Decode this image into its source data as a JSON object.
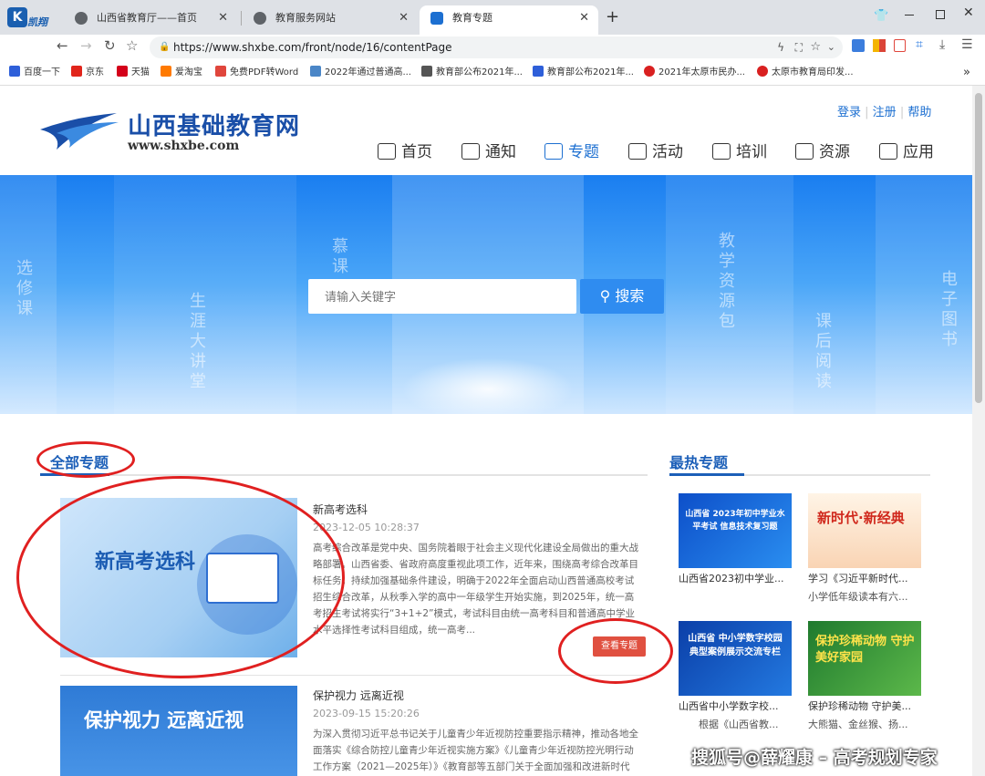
{
  "browser": {
    "tabs": [
      {
        "title": "山西省教育厅——首页"
      },
      {
        "title": "教育服务网站"
      },
      {
        "title": "教育专题"
      }
    ],
    "new_tab": "+",
    "url": "https://www.shxbe.com/front/node/16/contentPage",
    "logo_text": "凯翔",
    "bookmarks": [
      "百度一下",
      "京东",
      "天猫",
      "爱淘宝",
      "免费PDF转Word",
      "2022年通过普通高...",
      "教育部公布2021年...",
      "教育部公布2021年...",
      "2021年太原市民办...",
      "太原市教育局印发..."
    ],
    "bookmark_more": "»"
  },
  "site": {
    "name": "山西基础教育网",
    "domain": "www.shxbe.com",
    "top_links": [
      "登录",
      "注册",
      "帮助"
    ],
    "nav": [
      "首页",
      "通知",
      "专题",
      "活动",
      "培训",
      "资源",
      "应用"
    ],
    "active_nav": "专题",
    "accent": "#1c6fd1"
  },
  "banner": {
    "words": [
      "选修课",
      "生涯大讲堂",
      "慕课",
      "教学资源包",
      "课后阅读",
      "电子图书"
    ],
    "search_placeholder": "请输入关键字",
    "search_button": "搜索"
  },
  "all": {
    "heading": "全部专题",
    "items": [
      {
        "thumb_text": "新高考选科",
        "title": "新高考选科",
        "date": "2023-12-05 10:28:37",
        "desc": "高考综合改革是党中央、国务院着眼于社会主义现代化建设全局做出的重大战略部署。山西省委、省政府高度重视此项工作，近年来，围绕高考综合改革目标任务，持续加强基础条件建设，明确于2022年全面启动山西普通高校考试招生综合改革，从秋季入学的高中一年级学生开始实施，到2025年，统一高考招生考试将实行“3+1+2”模式，考试科目由统一高考科目和普通高中学业水平选择性考试科目组成，统一高考...",
        "button": "查看专题"
      },
      {
        "thumb_text": "保护视力 远离近视",
        "title": "保护视力 远离近视",
        "date": "2023-09-15 15:20:26",
        "desc": "为深入贯彻习近平总书记关于儿童青少年近视防控重要指示精神，推动各地全面落实《综合防控儿童青少年近视实施方案》《儿童青少年近视防控光明行动工作方案（2021—2025年）》《教育部等五部门关于全面加强和改进新时代学校卫生与健康教育工作的意见》"
      }
    ]
  },
  "hot": {
    "heading": "最热专题",
    "items": [
      {
        "thumb": "山西省 2023年初中学业水平考试 信息技术复习题",
        "caption": "山西省2023初中学业...",
        "sub": ""
      },
      {
        "thumb": "新时代·新经典",
        "caption": "学习《习近平新时代...",
        "sub": "小学低年级读本有六..."
      },
      {
        "thumb": "山西省 中小学数字校园 典型案例展示交流专栏",
        "caption": "山西省中小学数字校...",
        "sub": "根据《山西省教..."
      },
      {
        "thumb": "保护珍稀动物 守护美好家园",
        "caption": "保护珍稀动物 守护美...",
        "sub": "大熊猫、金丝猴、扬..."
      }
    ]
  },
  "watermark": "搜狐号@薛耀康 – 高考规划专家"
}
